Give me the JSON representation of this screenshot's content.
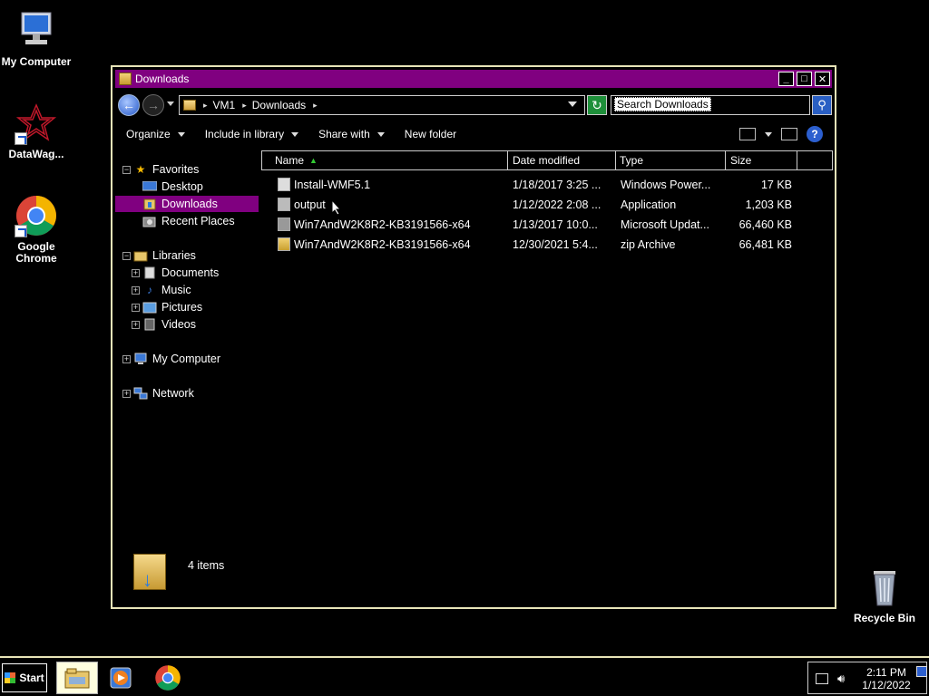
{
  "desktop": {
    "icons": [
      {
        "label": "My Computer"
      },
      {
        "label": "DataWag..."
      },
      {
        "label": "Google Chrome"
      },
      {
        "label": "Recycle Bin"
      }
    ]
  },
  "window": {
    "title": "Downloads",
    "address": {
      "crumbs": [
        "VM1",
        "Downloads"
      ]
    },
    "search_placeholder": "Search Downloads",
    "commands": [
      "Organize",
      "Include in library",
      "Share with",
      "New folder"
    ],
    "nav": {
      "favorites": "Favorites",
      "favorites_items": [
        "Desktop",
        "Downloads",
        "Recent Places"
      ],
      "libraries": "Libraries",
      "library_items": [
        "Documents",
        "Music",
        "Pictures",
        "Videos"
      ],
      "computer": "My Computer",
      "network": "Network",
      "selected": "Downloads"
    },
    "columns": [
      "Name",
      "Date modified",
      "Type",
      "Size"
    ],
    "files": [
      {
        "name": "Install-WMF5.1",
        "date": "1/18/2017 3:25 ...",
        "type": "Windows Power...",
        "size": "17 KB"
      },
      {
        "name": "output",
        "date": "1/12/2022 2:08 ...",
        "type": "Application",
        "size": "1,203 KB"
      },
      {
        "name": "Win7AndW2K8R2-KB3191566-x64",
        "date": "1/13/2017 10:0...",
        "type": "Microsoft Updat...",
        "size": "66,460 KB"
      },
      {
        "name": "Win7AndW2K8R2-KB3191566-x64",
        "date": "12/30/2021 5:4...",
        "type": "zip Archive",
        "size": "66,481 KB"
      }
    ],
    "status": "4 items"
  },
  "taskbar": {
    "start": "Start",
    "time": "2:11 PM",
    "date": "1/12/2022"
  },
  "colors": {
    "titlebar": "#800080",
    "selection": "#800080",
    "border": "#e8e4b8",
    "background": "#000000"
  }
}
